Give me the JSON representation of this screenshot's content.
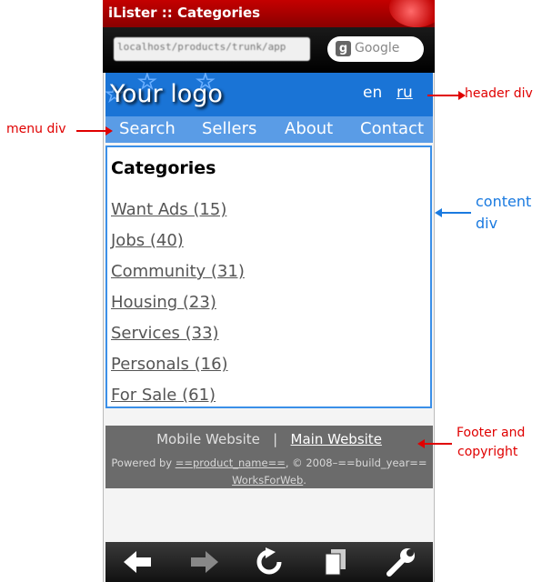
{
  "window": {
    "title": "iLister :: Categories"
  },
  "browser": {
    "url": "localhost/products/trunk/app",
    "search_placeholder": "Google",
    "search_logo": "g"
  },
  "header": {
    "logo": "Your logo",
    "lang_en": "en",
    "lang_ru": "ru"
  },
  "menu": {
    "items": [
      "Search",
      "Sellers",
      "About",
      "Contact"
    ]
  },
  "content": {
    "heading": "Categories",
    "categories": [
      "Want Ads (15)",
      "Jobs (40)",
      "Community (31)",
      "Housing (23)",
      "Services (33)",
      "Personals (16)",
      "For Sale (61)"
    ]
  },
  "footer": {
    "mobile": "Mobile Website",
    "sep": "|",
    "main": "Main Website",
    "powered": "Powered by",
    "product": "==product_name==",
    "copyright": ", © 2008–==build_year==",
    "company": "WorksForWeb",
    "period": "."
  },
  "annotations": {
    "header": "header div",
    "menu": "menu div",
    "content_line1": "content",
    "content_line2": "div",
    "footer_line1": "Footer and",
    "footer_line2": "copyright"
  },
  "colors": {
    "header_bg": "#1a74d6",
    "menu_bg": "#5a9ce6",
    "footer_bg": "#6b6b6b",
    "red_annotation": "#e00000",
    "blue_annotation": "#1a7ae0"
  },
  "icons": [
    "back-arrow-icon",
    "forward-arrow-icon",
    "reload-icon",
    "windows-icon",
    "wrench-icon"
  ]
}
